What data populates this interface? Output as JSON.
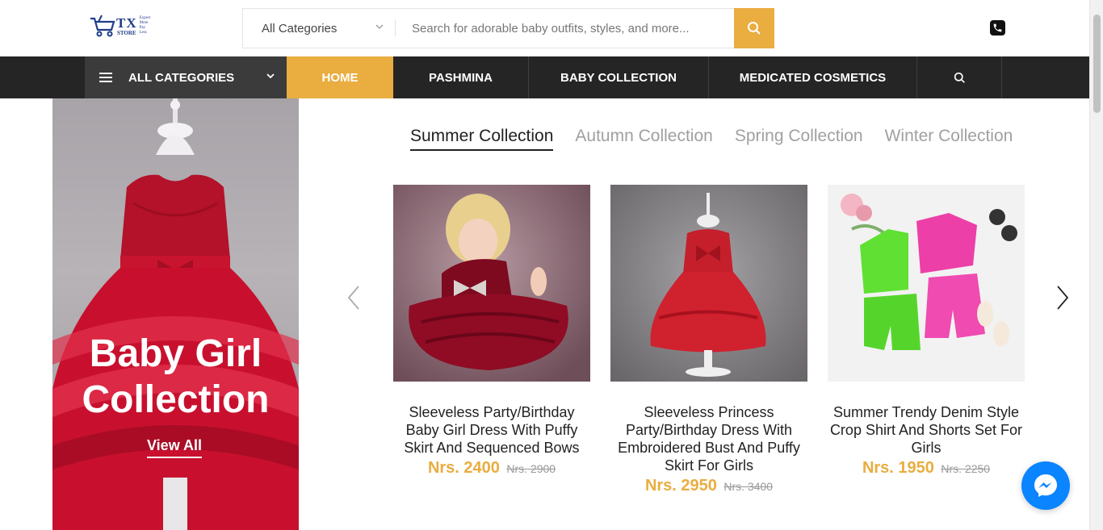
{
  "header": {
    "logo": {
      "brand": "TX",
      "sub": "STORE",
      "tagline": [
        "Expect",
        "More",
        "Pay",
        "Less"
      ]
    },
    "category_select": {
      "value": "All Categories"
    },
    "search": {
      "placeholder": "Search for adorable baby outfits, styles, and more..."
    },
    "icons": {
      "search_button": "search-icon",
      "phone": "phone-icon"
    },
    "accent_color": "#e9ad40"
  },
  "nav": {
    "all_categories": "ALL CATEGORIES",
    "items": [
      {
        "label": "HOME",
        "active": true
      },
      {
        "label": "PASHMINA",
        "active": false
      },
      {
        "label": "BABY COLLECTION",
        "active": false
      },
      {
        "label": "MEDICATED COSMETICS",
        "active": false
      }
    ],
    "bar_color": "#252525"
  },
  "hero": {
    "title_line1": "Baby Girl",
    "title_line2": "Collection",
    "link": "View All"
  },
  "tabs": [
    {
      "label": "Summer Collection",
      "active": true
    },
    {
      "label": "Autumn Collection",
      "active": false
    },
    {
      "label": "Spring Collection",
      "active": false
    },
    {
      "label": "Winter Collection",
      "active": false
    }
  ],
  "products": [
    {
      "name": "Sleeveless Party/Birthday Baby Girl Dress With Puffy Skirt And Sequenced Bows",
      "price": "Nrs. 2400",
      "old_price": "Nrs. 2900"
    },
    {
      "name": "Sleeveless Princess Party/Birthday Dress With Embroidered Bust And Puffy Skirt For Girls",
      "price": "Nrs. 2950",
      "old_price": "Nrs. 3400"
    },
    {
      "name": "Summer Trendy Denim Style Crop Shirt And Shorts Set For Girls",
      "price": "Nrs. 1950",
      "old_price": "Nrs. 2250"
    }
  ],
  "carousel": {
    "prev_icon": "chevron-left-icon",
    "next_icon": "chevron-right-icon"
  },
  "chat": {
    "icon": "messenger-icon",
    "color": "#0a84ff"
  }
}
